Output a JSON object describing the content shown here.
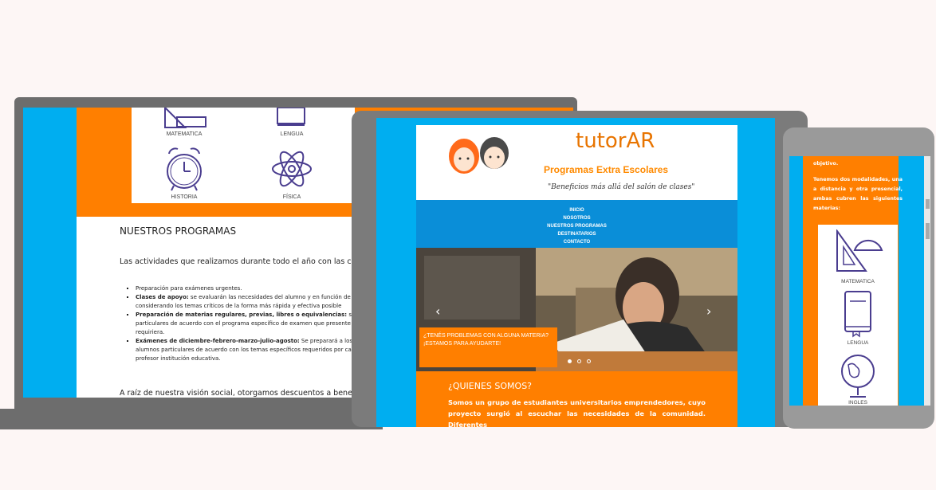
{
  "laptop": {
    "icon_labels": [
      "MATEMATICA",
      "LENGUA",
      "HISTORIA",
      "FÍSICA"
    ],
    "section_title": "NUESTROS PROGRAMAS",
    "intro": "Las actividades que realizamos durante todo el año con las clases p",
    "items": [
      {
        "bold": "",
        "text": "Preparación para exámenes urgentes."
      },
      {
        "bold": "Clases de apoyo:",
        "text": " se evaluarán las necesidades del alumno y en función de ellas considerando los temas críticos de la forma más rápida y efectiva posible"
      },
      {
        "bold": "Preparación de materias regulares, previas, libres o equivalencias:",
        "text": " se prep particulares de acuerdo con el programa específico de examen que presente requiriera."
      },
      {
        "bold": "Exámenes de diciembre-febrero-marzo-julio-agosto:",
        "text": " Se preparará a los alumnos particulares de acuerdo con los temas específicos requeridos por cada profesor institución educativa."
      }
    ],
    "footer": "A raíz de nuestra visión social, otorgamos descuentos a beneficiarial"
  },
  "tablet": {
    "brand": "tutorAR",
    "subtitle": "Programas Extra Escolares",
    "tagline": "\"Beneficios más allá del salón de clases\"",
    "nav": [
      "INICIO",
      "NOSOTROS",
      "NUESTROS PROGRAMAS",
      "DESTINATARIOS",
      "CONTACTO"
    ],
    "hero_caption_1": "¿TENÉS PROBLEMAS CON ALGUNA MATERIA?",
    "hero_caption_2": "¡ESTAMOS PARA AYUDARTE!",
    "who_title": "¿QUIENES SOMOS?",
    "who_text": "Somos un grupo de estudiantes universitarios emprendedores, cuyo proyecto surgió al escuchar las necesidades de la comunidad. Diferentes"
  },
  "phone": {
    "text_top": "objetivo.",
    "text_body": "Tenemos dos modalidades, una a distancia y otra presencial, ambas cubren las siguientes materias:",
    "icon_labels": [
      "MATEMATICA",
      "LENGUA",
      "INGLES"
    ]
  },
  "colors": {
    "orange": "#ff7f00",
    "blue": "#00aef0",
    "nav_blue": "#0a8ed8"
  }
}
